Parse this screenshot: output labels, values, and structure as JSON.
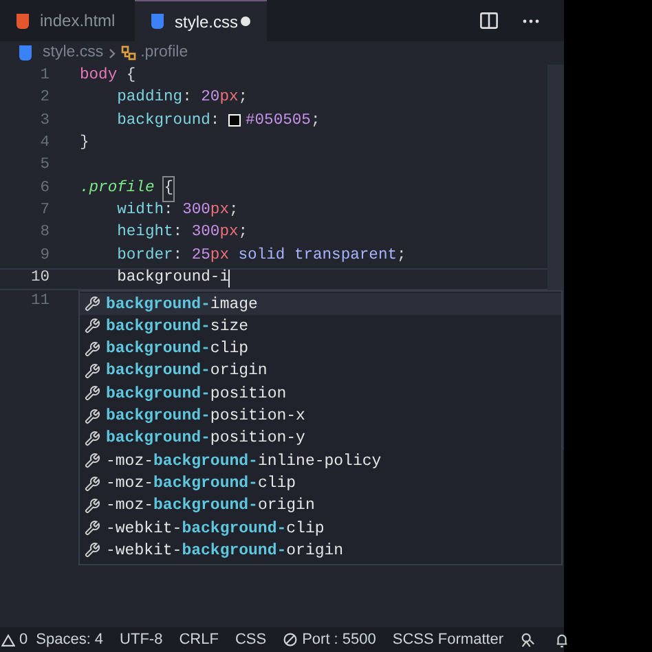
{
  "tabs": [
    {
      "label": "index.html",
      "kind": "html",
      "selected": false,
      "modified": false
    },
    {
      "label": "style.css",
      "kind": "css",
      "selected": true,
      "modified": true
    }
  ],
  "breadcrumb": {
    "file": "style.css",
    "symbol": ".profile"
  },
  "code_lines": [
    {
      "number": "1",
      "tokens": [
        {
          "text": "body",
          "kind": "tag"
        },
        {
          "text": " {",
          "kind": "punct"
        }
      ]
    },
    {
      "number": "2",
      "tokens": [
        {
          "text": "    padding",
          "kind": "prop"
        },
        {
          "text": ": ",
          "kind": "punct"
        },
        {
          "text": "20",
          "kind": "number"
        },
        {
          "text": "px",
          "kind": "unit"
        },
        {
          "text": ";",
          "kind": "punct"
        }
      ]
    },
    {
      "number": "3",
      "tokens": [
        {
          "text": "    background",
          "kind": "prop"
        },
        {
          "text": ": ",
          "kind": "punct"
        },
        {
          "kind": "swatch",
          "color": "#050505"
        },
        {
          "text": "#050505",
          "kind": "number"
        },
        {
          "text": ";",
          "kind": "punct"
        }
      ]
    },
    {
      "number": "4",
      "tokens": [
        {
          "text": "}",
          "kind": "punct"
        }
      ]
    },
    {
      "number": "5"
    },
    {
      "number": "6",
      "tokens": [
        {
          "text": ".profile",
          "kind": "selector"
        },
        {
          "text": "{",
          "kind": "bracket"
        }
      ]
    },
    {
      "number": "7",
      "tokens": [
        {
          "text": "    width",
          "kind": "prop"
        },
        {
          "text": ": ",
          "kind": "punct"
        },
        {
          "text": "300",
          "kind": "number"
        },
        {
          "text": "px",
          "kind": "unit"
        },
        {
          "text": ";",
          "kind": "punct"
        }
      ]
    },
    {
      "number": "8",
      "tokens": [
        {
          "text": "    height",
          "kind": "prop"
        },
        {
          "text": ": ",
          "kind": "punct"
        },
        {
          "text": "300",
          "kind": "number"
        },
        {
          "text": "px",
          "kind": "unit"
        },
        {
          "text": ";",
          "kind": "punct"
        }
      ]
    },
    {
      "number": "9",
      "tokens": [
        {
          "text": "    border",
          "kind": "prop"
        },
        {
          "text": ": ",
          "kind": "punct"
        },
        {
          "text": "25",
          "kind": "number"
        },
        {
          "text": "px",
          "kind": "unit"
        },
        {
          "text": " solid transparent",
          "kind": "value"
        },
        {
          "text": ";",
          "kind": "punct"
        }
      ]
    },
    {
      "number": "10",
      "current": true,
      "tokens": [
        {
          "text": "    background-i",
          "kind": "plain"
        }
      ]
    },
    {
      "number": "11"
    }
  ],
  "suggestions": [
    {
      "match": "background-",
      "rest": "image",
      "selected": true
    },
    {
      "match": "background-",
      "rest": "size",
      "selected": false
    },
    {
      "match": "background-",
      "rest": "clip",
      "selected": false
    },
    {
      "match": "background-",
      "rest": "origin",
      "selected": false
    },
    {
      "match": "background-",
      "rest": "position",
      "selected": false
    },
    {
      "match": "background-",
      "rest": "position-x",
      "selected": false
    },
    {
      "match": "background-",
      "rest": "position-y",
      "selected": false
    },
    {
      "prefix": "-moz-",
      "match": "background-",
      "rest": "inline-policy",
      "selected": false
    },
    {
      "prefix": "-moz-",
      "match": "background-",
      "rest": "clip",
      "selected": false
    },
    {
      "prefix": "-moz-",
      "match": "background-",
      "rest": "origin",
      "selected": false
    },
    {
      "prefix": "-webkit-",
      "match": "background-",
      "rest": "clip",
      "selected": false
    },
    {
      "prefix": "-webkit-",
      "match": "background-",
      "rest": "origin",
      "selected": false
    }
  ],
  "status_bar": {
    "warnings": "0",
    "items": [
      {
        "text": "Spaces: 4"
      },
      {
        "text": "UTF-8"
      },
      {
        "text": "CRLF"
      },
      {
        "text": "CSS"
      },
      {
        "text": "Port : 5500",
        "kind": "server"
      },
      {
        "text": "SCSS Formatter"
      }
    ]
  }
}
